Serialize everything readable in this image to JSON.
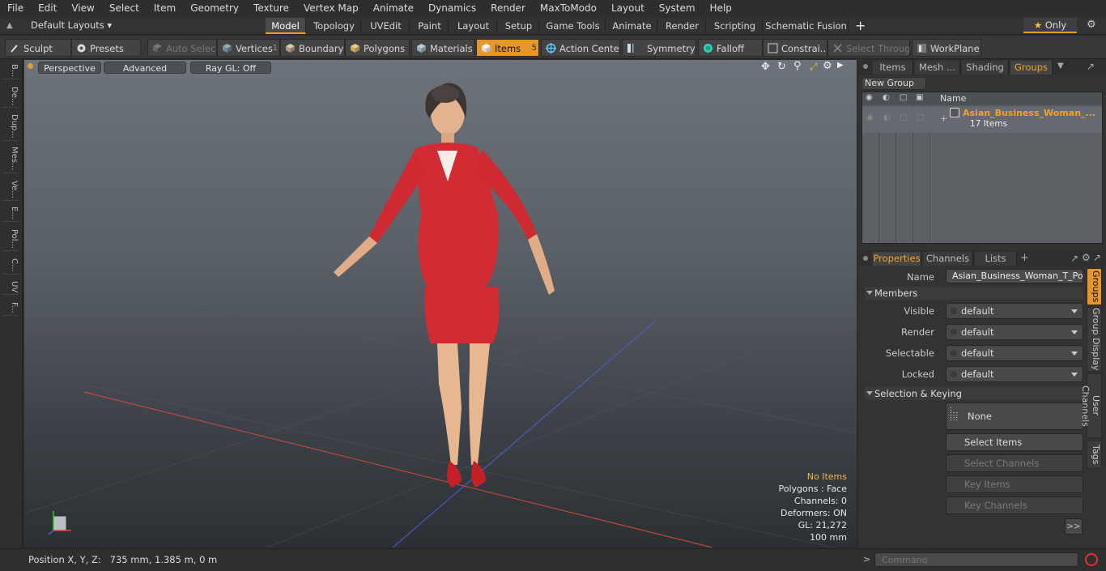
{
  "menu": [
    "File",
    "Edit",
    "View",
    "Select",
    "Item",
    "Geometry",
    "Texture",
    "Vertex Map",
    "Animate",
    "Dynamics",
    "Render",
    "MaxToModo",
    "Layout",
    "System",
    "Help"
  ],
  "layouts": {
    "selector": "Default Layouts",
    "tabs": [
      "Model",
      "Topology",
      "UVEdit",
      "Paint",
      "Layout",
      "Setup",
      "Game Tools",
      "Animate",
      "Render",
      "Scripting",
      "Schematic Fusion"
    ],
    "active": "Model",
    "only_label": "Only"
  },
  "toolbar": {
    "sculpt": "Sculpt",
    "presets": "Presets",
    "auto_select": "Auto Select",
    "vertices": "Vertices",
    "vertices_count": "1",
    "boundary": "Boundary",
    "polygons": "Polygons",
    "materials": "Materials",
    "items": "Items",
    "items_count": "5",
    "action_center": "Action Center",
    "symmetry": "Symmetry",
    "falloff": "Falloff",
    "constraints": "Constrai...",
    "select_through": "Select Through",
    "workplane": "WorkPlane"
  },
  "left_tabs": [
    "B...",
    "De...",
    "Dup...",
    "Mes...",
    "Ve...",
    "E...",
    "Pol...",
    "C...",
    "UV",
    "F..."
  ],
  "viewport": {
    "view": "Perspective",
    "shading": "Advanced",
    "raygl": "Ray GL: Off",
    "hud": {
      "selection": "No Items",
      "polygons": "Polygons : Face",
      "channels": "Channels: 0",
      "deformers": "Deformers: ON",
      "gl": "GL: 21,272",
      "scale": "100 mm"
    }
  },
  "status": {
    "position": "Position X, Y, Z:   735 mm, 1.385 m, 0 m"
  },
  "groups_panel": {
    "tabs": [
      "Items",
      "Mesh ...",
      "Shading",
      "Groups"
    ],
    "active": "Groups",
    "new_group": "New Group",
    "name_header": "Name",
    "group_name": "Asian_Business_Woman_...",
    "group_count": "17 Items"
  },
  "properties": {
    "tabs": [
      "Properties",
      "Channels",
      "Lists"
    ],
    "name_label": "Name",
    "name_value": "Asian_Business_Woman_T_Pose",
    "members": "Members",
    "rows": [
      {
        "label": "Visible",
        "value": "default"
      },
      {
        "label": "Render",
        "value": "default"
      },
      {
        "label": "Selectable",
        "value": "default"
      },
      {
        "label": "Locked",
        "value": "default"
      }
    ],
    "selection_keying": "Selection & Keying",
    "none": "None",
    "select_items": "Select Items",
    "select_channels": "Select Channels",
    "key_items": "Key Items",
    "key_channels": "Key Channels",
    "more": ">>",
    "side_tabs": [
      "Groups",
      "Group Display",
      "User Channels",
      "Tags"
    ]
  },
  "command": {
    "placeholder": "Command"
  },
  "colors": {
    "accent": "#e8962a",
    "group_name": "#f0a030",
    "x_axis": "#d34b3b",
    "z_axis": "#4b5fd3"
  }
}
